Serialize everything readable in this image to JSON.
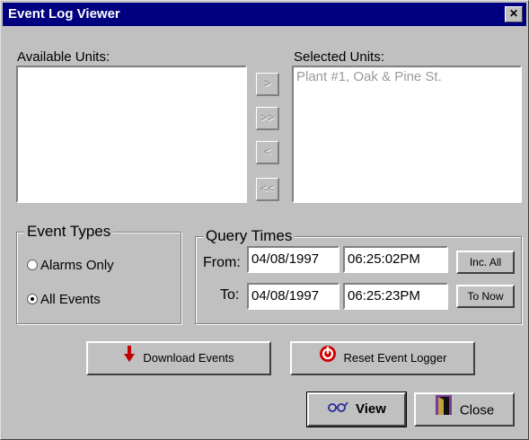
{
  "window": {
    "title": "Event Log Viewer",
    "close_glyph": "✕"
  },
  "units": {
    "available_label": "Available Units:",
    "available_items": [],
    "selected_label": "Selected Units:",
    "selected_items": [
      "Plant #1, Oak & Pine St."
    ],
    "move_buttons": {
      "add": ">",
      "add_all": ">>",
      "remove": "<",
      "remove_all": "<<"
    }
  },
  "event_types": {
    "title": "Event Types",
    "options": [
      {
        "label": "Alarms Only",
        "checked": false
      },
      {
        "label": "All Events",
        "checked": true
      }
    ]
  },
  "query_times": {
    "title": "Query Times",
    "from_label": "From:",
    "from_date": "04/08/1997",
    "from_time": "06:25:02PM",
    "to_label": "To:",
    "to_date": "04/08/1997",
    "to_time": "06:25:23PM",
    "inc_all_label": "Inc. All",
    "to_now_label": "To Now"
  },
  "actions": {
    "download_label": "Download Events",
    "reset_label": "Reset Event Logger",
    "view_label": "View",
    "close_label": "Close"
  },
  "icons": {
    "download": "down-arrow-icon",
    "reset": "power-reset-icon",
    "view": "glasses-icon",
    "close": "door-icon"
  }
}
